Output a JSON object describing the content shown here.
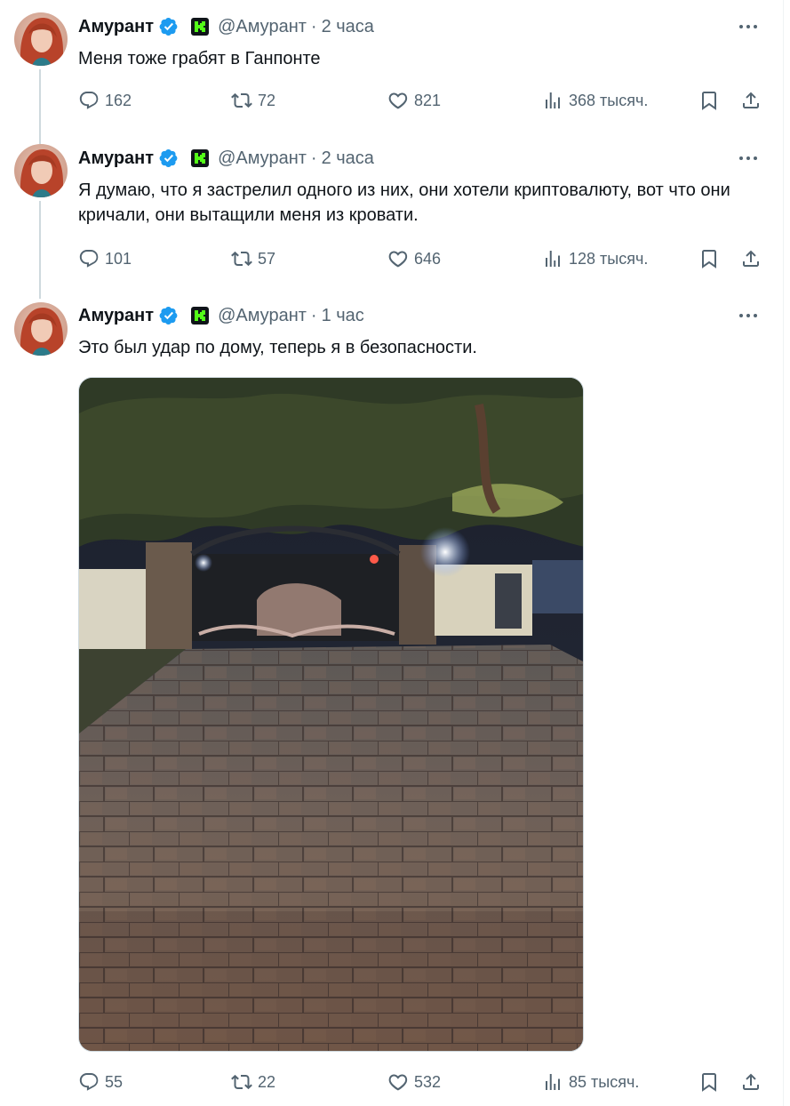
{
  "tweets": [
    {
      "name": "Амурант",
      "handle": "@Амурант",
      "time": "2 часа",
      "text": "Меня тоже грабят в Ганпонте",
      "replies": "162",
      "retweets": "72",
      "likes": "821",
      "views": "368 тысяч."
    },
    {
      "name": "Амурант",
      "handle": "@Амурант",
      "time": "2 часа",
      "text": "Я думаю, что я застрелил одного из них, они хотели криптовалюту, вот что они кричали, они вытащили меня из кровати.",
      "replies": "101",
      "retweets": "57",
      "likes": "646",
      "views": "128 тысяч."
    },
    {
      "name": "Амурант",
      "handle": "@Амурант",
      "time": "1 час",
      "text": "Это был удар по дому, теперь я в безопасности.",
      "replies": "55",
      "retweets": "22",
      "likes": "532",
      "views": "85 тысяч."
    }
  ],
  "colors": {
    "text": "#0f1419",
    "secondary": "#536471",
    "verified": "#1d9bf0",
    "kick": "#53fc18",
    "thread_line": "#cfd9de"
  },
  "icons": [
    "verified-badge-icon",
    "kick-logo-icon",
    "more-icon",
    "reply-icon",
    "retweet-icon",
    "like-icon",
    "views-icon",
    "bookmark-icon",
    "share-icon"
  ]
}
